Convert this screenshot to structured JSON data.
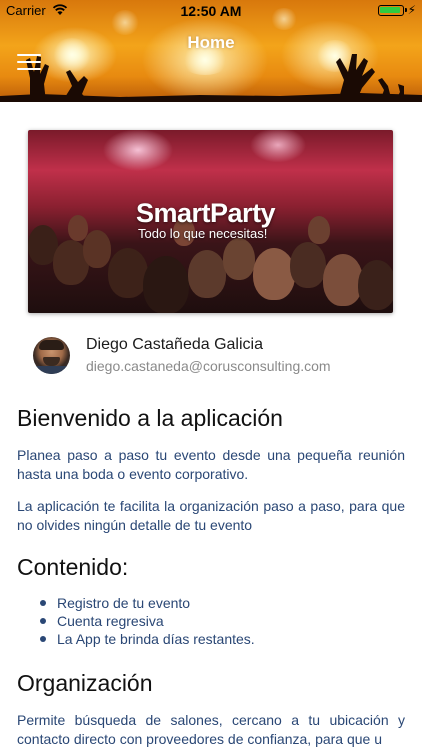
{
  "status_bar": {
    "carrier": "Carrier",
    "time": "12:50 AM"
  },
  "header": {
    "title": "Home",
    "menu_icon": "hamburger-icon"
  },
  "banner": {
    "title": "SmartParty",
    "subtitle": "Todo lo que necesitas!"
  },
  "profile": {
    "name": "Diego Castañeda Galicia",
    "email": "diego.castaneda@corusconsulting.com"
  },
  "welcome": {
    "heading": "Bienvenido a la aplicación",
    "paragraphs": [
      "Planea paso a paso tu evento desde una pequeña reunión hasta una boda o evento corporativo.",
      "La aplicación te facilita la organización paso a paso, para que no olvides ningún detalle de tu evento"
    ]
  },
  "contents": {
    "heading": "Contenido:",
    "items": [
      "Registro de tu evento",
      "Cuenta regresiva",
      "La App te brinda días restantes."
    ]
  },
  "organization": {
    "heading": "Organización",
    "paragraph": "Permite búsqueda de salones, cercano a tu ubicación y contacto directo con proveedores de confianza, para que u"
  },
  "colors": {
    "body_text": "#2a4775",
    "header_orange": "#f3a41a",
    "battery_green": "#2ecc40"
  }
}
